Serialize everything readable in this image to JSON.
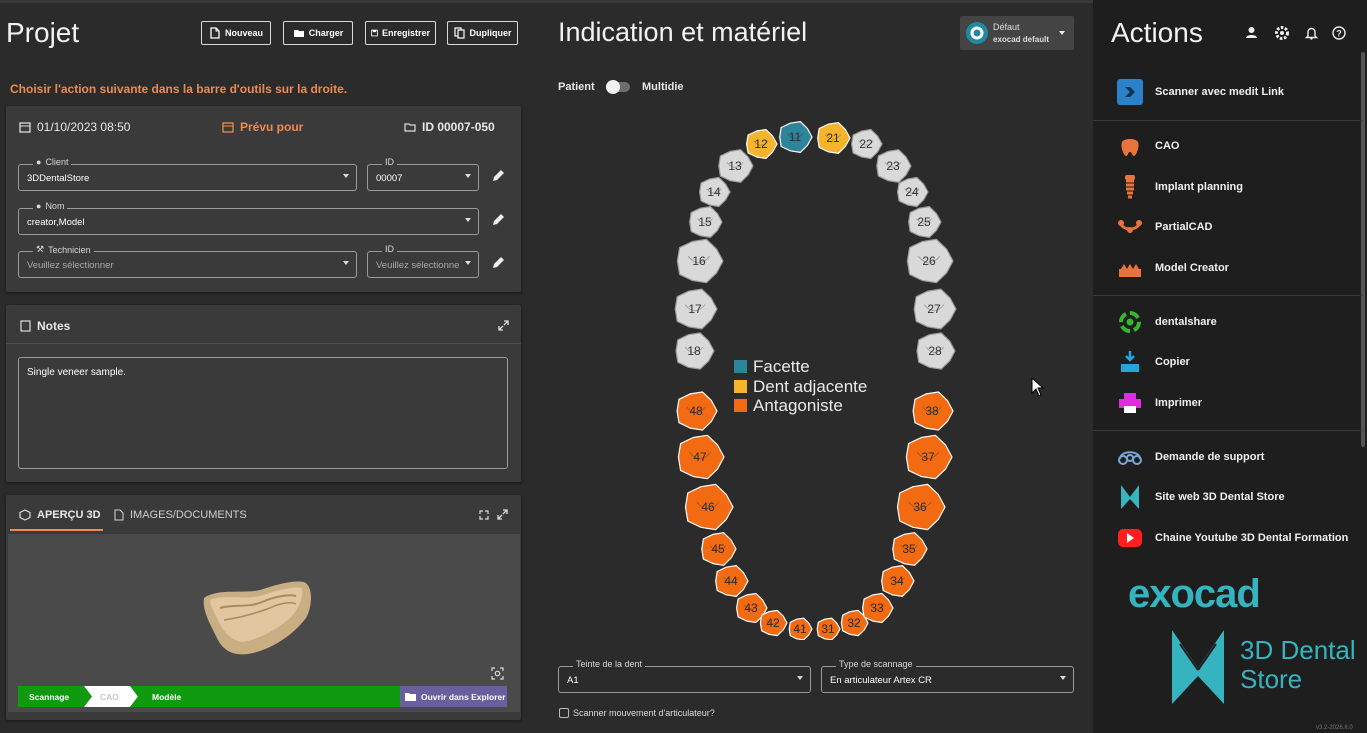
{
  "project": {
    "title": "Projet",
    "buttons": {
      "new": "Nouveau",
      "load": "Charger",
      "save": "Enregistrer",
      "duplicate": "Dupliquer"
    },
    "hint": "Choisir l'action suivante dans la barre d'outils sur la droite.",
    "date": "01/10/2023 08:50",
    "due": "Prévu pour",
    "id_label": "ID 00007-050",
    "client": {
      "label": "Client",
      "value": "3DDentalStore"
    },
    "client_id": {
      "label": "ID",
      "value": "00007"
    },
    "name": {
      "label": "Nom",
      "value": "creator,Model"
    },
    "technician": {
      "label": "Technicien",
      "placeholder": "Veuillez sélectionner"
    },
    "technician_id": {
      "label": "ID",
      "placeholder": "Veuillez sélectionne"
    }
  },
  "notes": {
    "title": "Notes",
    "text": "Single veneer sample."
  },
  "preview": {
    "tab_3d": "APERÇU 3D",
    "tab_docs": "IMAGES/DOCUMENTS",
    "steps": [
      "Scannage",
      "CAO",
      "Modèle"
    ],
    "open_explorer": "Ouvrir dans Explorer"
  },
  "indication": {
    "title": "Indication et matériel",
    "profile_name": "Défaut",
    "profile_sub": "exocad default",
    "toggle_left": "Patient",
    "toggle_right": "Multidie",
    "legend": [
      {
        "label": "Facette",
        "color": "#2e8499"
      },
      {
        "label": "Dent adjacente",
        "color": "#f5b32e"
      },
      {
        "label": "Antagoniste",
        "color": "#f26b12"
      }
    ],
    "shade": {
      "label": "Teinte de la dent",
      "value": "A1"
    },
    "scan_type": {
      "label": "Type de scannage",
      "value": "En articulateur Artex CR"
    },
    "scan_motion": "Scanner mouvement d'articulateur?",
    "colors": {
      "veneer": "#2e8499",
      "adjacent": "#f5b32e",
      "antagonist": "#f26b12",
      "none": "#d9d9d9"
    },
    "teeth_upper": [
      {
        "n": "18",
        "t": "none"
      },
      {
        "n": "17",
        "t": "none"
      },
      {
        "n": "16",
        "t": "none"
      },
      {
        "n": "15",
        "t": "none"
      },
      {
        "n": "14",
        "t": "none"
      },
      {
        "n": "13",
        "t": "none"
      },
      {
        "n": "12",
        "t": "adjacent"
      },
      {
        "n": "11",
        "t": "veneer"
      },
      {
        "n": "21",
        "t": "adjacent"
      },
      {
        "n": "22",
        "t": "none"
      },
      {
        "n": "23",
        "t": "none"
      },
      {
        "n": "24",
        "t": "none"
      },
      {
        "n": "25",
        "t": "none"
      },
      {
        "n": "26",
        "t": "none"
      },
      {
        "n": "27",
        "t": "none"
      },
      {
        "n": "28",
        "t": "none"
      }
    ],
    "teeth_lower": [
      {
        "n": "48",
        "t": "antagonist"
      },
      {
        "n": "47",
        "t": "antagonist"
      },
      {
        "n": "46",
        "t": "antagonist"
      },
      {
        "n": "45",
        "t": "antagonist"
      },
      {
        "n": "44",
        "t": "antagonist"
      },
      {
        "n": "43",
        "t": "antagonist"
      },
      {
        "n": "42",
        "t": "antagonist"
      },
      {
        "n": "41",
        "t": "antagonist"
      },
      {
        "n": "31",
        "t": "antagonist"
      },
      {
        "n": "32",
        "t": "antagonist"
      },
      {
        "n": "33",
        "t": "antagonist"
      },
      {
        "n": "34",
        "t": "antagonist"
      },
      {
        "n": "35",
        "t": "antagonist"
      },
      {
        "n": "36",
        "t": "antagonist"
      },
      {
        "n": "37",
        "t": "antagonist"
      },
      {
        "n": "38",
        "t": "antagonist"
      }
    ]
  },
  "actions": {
    "title": "Actions",
    "items": [
      {
        "label": "Scanner avec medit Link",
        "icon": "medit-link-icon"
      },
      {
        "label": "CAO",
        "icon": "cad-tooth-icon"
      },
      {
        "label": "Implant planning",
        "icon": "implant-icon"
      },
      {
        "label": "PartialCAD",
        "icon": "partial-denture-icon"
      },
      {
        "label": "Model Creator",
        "icon": "model-creator-icon"
      },
      {
        "label": "dentalshare",
        "icon": "dentalshare-icon"
      },
      {
        "label": "Copier",
        "icon": "copy-icon"
      },
      {
        "label": "Imprimer",
        "icon": "print-icon"
      },
      {
        "label": "Demande de support",
        "icon": "support-icon"
      },
      {
        "label": "Site web 3D Dental Store",
        "icon": "website-icon"
      },
      {
        "label": "Chaine Youtube 3D Dental Formation",
        "icon": "youtube-icon"
      }
    ],
    "brand": "exocad",
    "store_line1": "3D Dental",
    "store_line2": "Store",
    "version": "v3.2-2026.II.0"
  }
}
